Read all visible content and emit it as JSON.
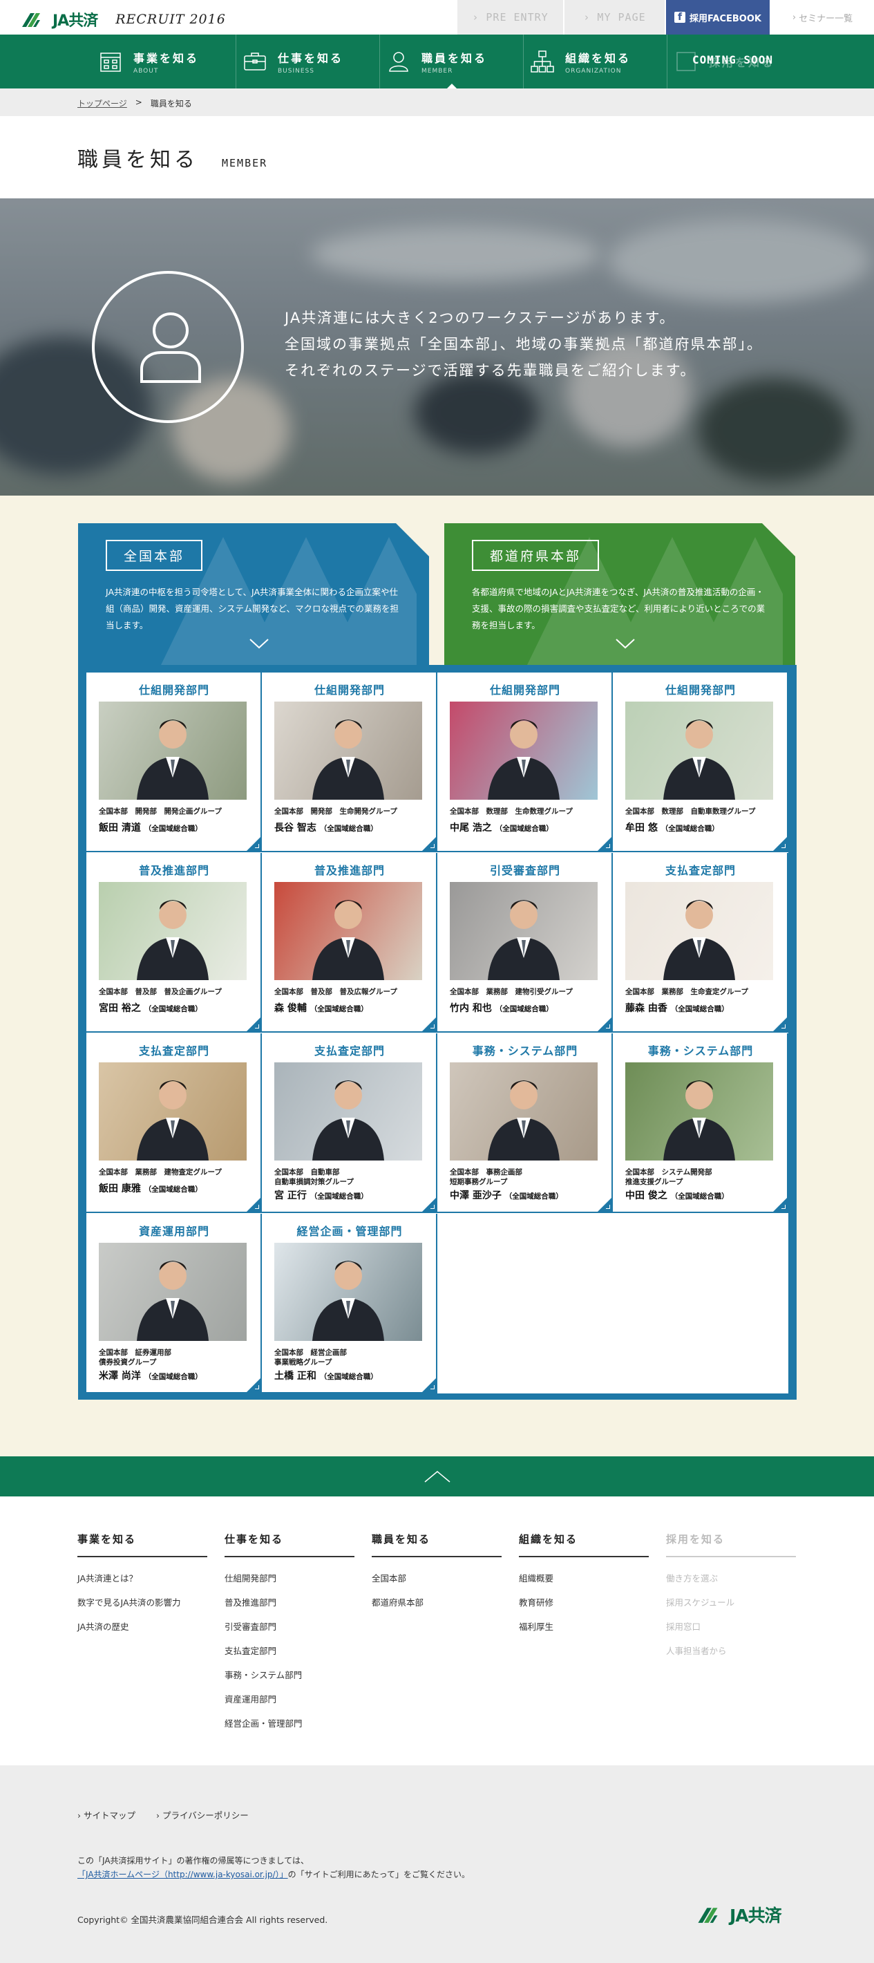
{
  "header": {
    "logo_text": "JA共済",
    "recruit_label": "RECRUIT 2016",
    "pre_entry": "PRE ENTRY",
    "mypage": "MY PAGE",
    "facebook": "採用FACEBOOK",
    "seminar": "セミナー一覧"
  },
  "nav": [
    {
      "jp": "事業を知る",
      "en": "ABOUT",
      "icon": "building-icon"
    },
    {
      "jp": "仕事を知る",
      "en": "BUSINESS",
      "icon": "briefcase-icon"
    },
    {
      "jp": "職員を知る",
      "en": "MEMBER",
      "icon": "person-icon"
    },
    {
      "jp": "組織を知る",
      "en": "ORGANIZATION",
      "icon": "org-chart-icon"
    },
    {
      "jp": "採用を知る",
      "en": "",
      "icon": "document-icon",
      "badge": "COMING SOON"
    }
  ],
  "breadcrumb": {
    "home": "トップページ",
    "sep": ">",
    "current": "職員を知る"
  },
  "page_title": {
    "jp": "職員を知る",
    "en": "MEMBER"
  },
  "hero": {
    "lines": [
      "JA共済連には大きく2つのワークステージがあります。",
      "全国域の事業拠点「全国本部」、地域の事業拠点「都道府県本部」。",
      "それぞれのステージで活躍する先輩職員をご紹介します。"
    ]
  },
  "categories": [
    {
      "title": "全国本部",
      "desc": "JA共済連の中枢を担う司令塔として、JA共済事業全体に関わる企画立案や仕組（商品）開発、資産運用、システム開発など、マクロな視点での業務を担当します。"
    },
    {
      "title": "都道府県本部",
      "desc": "各都道府県で地域のJAとJA共済連をつなぎ、JA共済の普及推進活動の企画・支援、事故の際の損害調査や支払査定など、利用者により近いところでの業務を担当します。"
    }
  ],
  "members": [
    {
      "dept": "仕組開発部門",
      "org": "全国本部　開発部　開発企画グループ",
      "name": "飯田 清道",
      "type": "（全国域総合職）"
    },
    {
      "dept": "仕組開発部門",
      "org": "全国本部　開発部　生命開発グループ",
      "name": "長谷 智志",
      "type": "（全国域総合職）"
    },
    {
      "dept": "仕組開発部門",
      "org": "全国本部　数理部　生命数理グループ",
      "name": "中尾 浩之",
      "type": "（全国域総合職）"
    },
    {
      "dept": "仕組開発部門",
      "org": "全国本部　数理部　自動車数理グループ",
      "name": "牟田 悠",
      "type": "（全国域総合職）"
    },
    {
      "dept": "普及推進部門",
      "org": "全国本部　普及部　普及企画グループ",
      "name": "宮田 裕之",
      "type": "（全国域総合職）"
    },
    {
      "dept": "普及推進部門",
      "org": "全国本部　普及部　普及広報グループ",
      "name": "森 俊輔",
      "type": "（全国域総合職）"
    },
    {
      "dept": "引受審査部門",
      "org": "全国本部　業務部　建物引受グループ",
      "name": "竹内 和也",
      "type": "（全国域総合職）"
    },
    {
      "dept": "支払査定部門",
      "org": "全国本部　業務部　生命査定グループ",
      "name": "藤森 由香",
      "type": "（全国域総合職）"
    },
    {
      "dept": "支払査定部門",
      "org": "全国本部　業務部　建物査定グループ",
      "name": "飯田 康雅",
      "type": "（全国域総合職）"
    },
    {
      "dept": "支払査定部門",
      "org": "全国本部　自動車部\n自動車損調対策グループ",
      "name": "宮 正行",
      "type": "（全国域総合職）"
    },
    {
      "dept": "事務・システム部門",
      "org": "全国本部　事務企画部\n短期事務グループ",
      "name": "中澤 亜沙子",
      "type": "（全国域総合職）"
    },
    {
      "dept": "事務・システム部門",
      "org": "全国本部　システム開発部\n推進支援グループ",
      "name": "中田 俊之",
      "type": "（全国域総合職）"
    },
    {
      "dept": "資産運用部門",
      "org": "全国本部　証券運用部\n債券投資グループ",
      "name": "米澤 尚洋",
      "type": "（全国域総合職）"
    },
    {
      "dept": "経営企画・管理部門",
      "org": "全国本部　経営企画部\n事業戦略グループ",
      "name": "土橋 正和",
      "type": "（全国域総合職）"
    }
  ],
  "footer_nav": [
    {
      "heading": "事業を知る",
      "items": [
        "JA共済連とは？",
        "数字で見るJA共済の影響力",
        "JA共済の歴史"
      ]
    },
    {
      "heading": "仕事を知る",
      "items": [
        "仕組開発部門",
        "普及推進部門",
        "引受審査部門",
        "支払査定部門",
        "事務・システム部門",
        "資産運用部門",
        "経営企画・管理部門"
      ]
    },
    {
      "heading": "職員を知る",
      "items": [
        "全国本部",
        "都道府県本部"
      ]
    },
    {
      "heading": "組織を知る",
      "items": [
        "組織概要",
        "教育研修",
        "福利厚生"
      ]
    },
    {
      "heading": "採用を知る",
      "items": [
        "働き方を選ぶ",
        "採用スケジュール",
        "採用窓口",
        "人事担当者から"
      ]
    }
  ],
  "footer": {
    "links": [
      "サイトマップ",
      "プライバシーポリシー"
    ],
    "note_1": "この「JA共済採用サイト」の著作権の帰属等につきましては、",
    "note_link": "「JA共済ホームページ（http://www.ja-kyosai.or.jp/）」",
    "note_2": "の「サイトご利用にあたって」をご覧ください。",
    "copyright": "Copyright© 全国共済農業協同組合連合会 All rights reserved.",
    "logo_text": "JA共済"
  },
  "colors": {
    "brand_green": "#0e7a55",
    "accent_blue": "#1e78a7",
    "accent_green": "#3e8e36",
    "facebook": "#3b5998"
  }
}
